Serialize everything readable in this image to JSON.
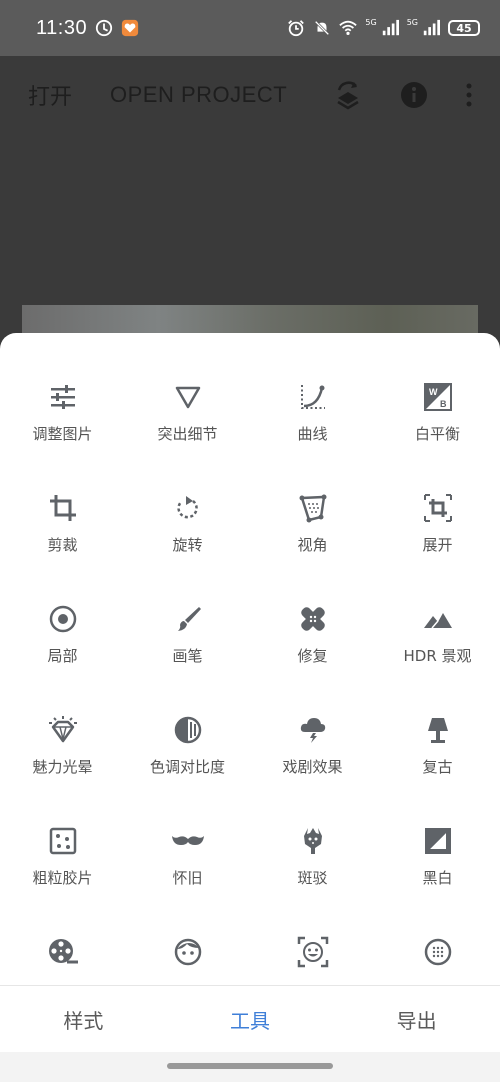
{
  "status": {
    "time": "11:30",
    "battery": "45",
    "net1": "5G",
    "net2": "5G"
  },
  "appbar": {
    "open_label": "打开",
    "project_label": "OPEN PROJECT"
  },
  "tools": [
    {
      "label": "调整图片",
      "icon": "tune-icon"
    },
    {
      "label": "突出细节",
      "icon": "triangle-icon"
    },
    {
      "label": "曲线",
      "icon": "curves-icon"
    },
    {
      "label": "白平衡",
      "icon": "white-balance-icon"
    },
    {
      "label": "剪裁",
      "icon": "crop-icon"
    },
    {
      "label": "旋转",
      "icon": "rotate-icon"
    },
    {
      "label": "视角",
      "icon": "perspective-icon"
    },
    {
      "label": "展开",
      "icon": "expand-icon"
    },
    {
      "label": "局部",
      "icon": "selective-icon"
    },
    {
      "label": "画笔",
      "icon": "brush-icon"
    },
    {
      "label": "修复",
      "icon": "healing-icon"
    },
    {
      "label": "HDR 景观",
      "icon": "mountains-icon"
    },
    {
      "label": "魅力光晕",
      "icon": "glamour-glow-icon"
    },
    {
      "label": "色调对比度",
      "icon": "tonal-contrast-icon"
    },
    {
      "label": "戏剧效果",
      "icon": "drama-icon"
    },
    {
      "label": "复古",
      "icon": "vintage-lamp-icon"
    },
    {
      "label": "粗粒胶片",
      "icon": "grainy-film-icon"
    },
    {
      "label": "怀旧",
      "icon": "mustache-icon"
    },
    {
      "label": "斑驳",
      "icon": "grunge-icon"
    },
    {
      "label": "黑白",
      "icon": "black-white-icon"
    },
    {
      "label": "",
      "icon": "film-reel-icon"
    },
    {
      "label": "",
      "icon": "face-icon"
    },
    {
      "label": "",
      "icon": "face-frame-icon"
    },
    {
      "label": "",
      "icon": "lens-blur-icon"
    }
  ],
  "nav": {
    "styles": "样式",
    "tools": "工具",
    "export": "导出"
  },
  "colors": {
    "accent": "#3f7fd8",
    "icon": "#5f6368"
  }
}
